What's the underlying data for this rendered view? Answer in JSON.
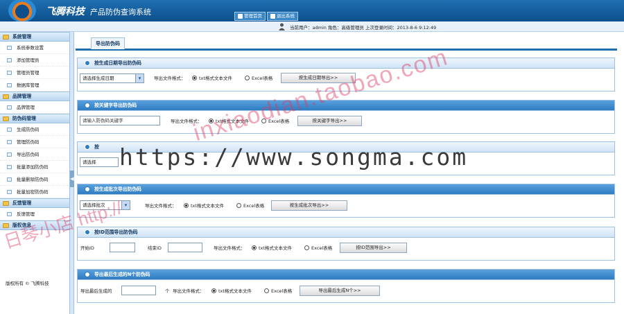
{
  "header": {
    "brand": "飞腾科技",
    "system_title": "产品防伪查询系统",
    "nav": [
      {
        "label": "管理首页",
        "icon": "home-icon"
      },
      {
        "label": "退出系统",
        "icon": "exit-icon"
      }
    ]
  },
  "infobar": {
    "user_info": "当前用户：admin 角色：高级管理员  上次登录时间：2013-8-6 9:12:49"
  },
  "sidebar": {
    "groups": [
      {
        "title": "系统管理",
        "items": [
          "系统参数设置",
          "添加管理员",
          "管理员管理",
          "数据库管理"
        ]
      },
      {
        "title": "品牌管理",
        "items": [
          "品牌管理"
        ]
      },
      {
        "title": "防伪码管理",
        "items": [
          "生成防伪码",
          "管理防伪码",
          "导出防伪码",
          "批量添加防伪码",
          "批量删除防伪码",
          "批量加密防伪码"
        ]
      },
      {
        "title": "反馈管理",
        "items": [
          "反馈管理"
        ]
      },
      {
        "title": "版权信息",
        "items": []
      }
    ],
    "copyright": "版权所有 © 飞腾科技"
  },
  "main": {
    "page_title": "导出防伪码",
    "format_label": "导出文件格式：",
    "radio_txt": "txt格式文本文件",
    "radio_excel": "Excel表格",
    "panels": [
      {
        "title": "按生成日期导出防伪码",
        "select_value": "请选择生成日期",
        "button": "按生成日期导出>>"
      },
      {
        "title": "按关键字导出防伪码",
        "input_value": "请输入防伪码关键字",
        "button": "按关键字导出>>"
      },
      {
        "title": "按",
        "select_value": "请选择"
      },
      {
        "title": "按生成批次导出防伪码",
        "select_value": "请选择批次",
        "button": "按生成批次导出>>"
      },
      {
        "title": "按ID范围导出防伪码",
        "start_label": "开始ID",
        "end_label": "结束ID",
        "button": "按ID范围导出>>"
      },
      {
        "title": "导出最后生成的N个防伪码",
        "prefix_label": "导出最后生成的",
        "suffix_label": "个",
        "button": "导出最后生成N个>>"
      }
    ]
  },
  "watermarks": {
    "url": "https://www.songma.com",
    "diag": "inxiaodian.taobao.com",
    "diag2": "日琴小店 http://"
  }
}
